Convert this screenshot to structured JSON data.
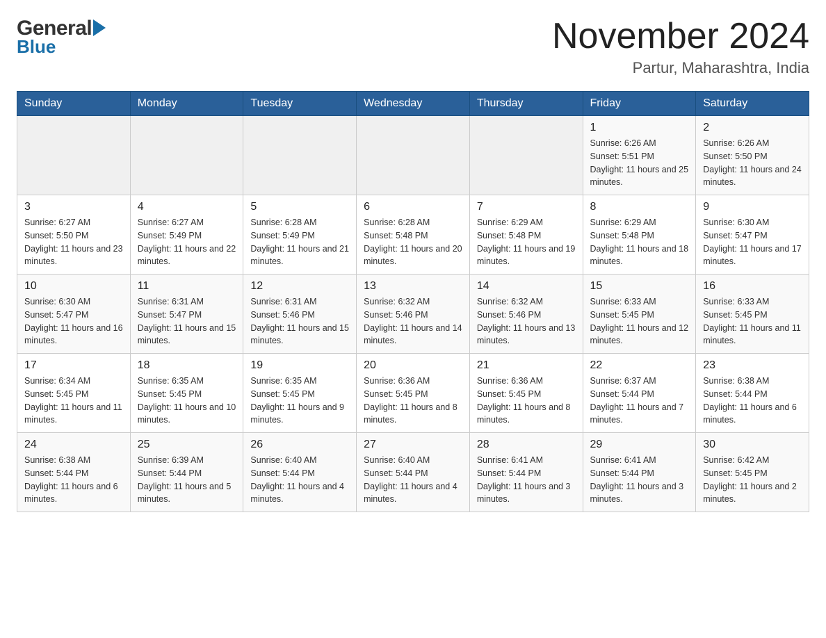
{
  "logo": {
    "line1": "General",
    "line2": "Blue"
  },
  "title": {
    "month_year": "November 2024",
    "location": "Partur, Maharashtra, India"
  },
  "weekdays": [
    "Sunday",
    "Monday",
    "Tuesday",
    "Wednesday",
    "Thursday",
    "Friday",
    "Saturday"
  ],
  "weeks": [
    [
      {
        "day": "",
        "sunrise": "",
        "sunset": "",
        "daylight": ""
      },
      {
        "day": "",
        "sunrise": "",
        "sunset": "",
        "daylight": ""
      },
      {
        "day": "",
        "sunrise": "",
        "sunset": "",
        "daylight": ""
      },
      {
        "day": "",
        "sunrise": "",
        "sunset": "",
        "daylight": ""
      },
      {
        "day": "",
        "sunrise": "",
        "sunset": "",
        "daylight": ""
      },
      {
        "day": "1",
        "sunrise": "Sunrise: 6:26 AM",
        "sunset": "Sunset: 5:51 PM",
        "daylight": "Daylight: 11 hours and 25 minutes."
      },
      {
        "day": "2",
        "sunrise": "Sunrise: 6:26 AM",
        "sunset": "Sunset: 5:50 PM",
        "daylight": "Daylight: 11 hours and 24 minutes."
      }
    ],
    [
      {
        "day": "3",
        "sunrise": "Sunrise: 6:27 AM",
        "sunset": "Sunset: 5:50 PM",
        "daylight": "Daylight: 11 hours and 23 minutes."
      },
      {
        "day": "4",
        "sunrise": "Sunrise: 6:27 AM",
        "sunset": "Sunset: 5:49 PM",
        "daylight": "Daylight: 11 hours and 22 minutes."
      },
      {
        "day": "5",
        "sunrise": "Sunrise: 6:28 AM",
        "sunset": "Sunset: 5:49 PM",
        "daylight": "Daylight: 11 hours and 21 minutes."
      },
      {
        "day": "6",
        "sunrise": "Sunrise: 6:28 AM",
        "sunset": "Sunset: 5:48 PM",
        "daylight": "Daylight: 11 hours and 20 minutes."
      },
      {
        "day": "7",
        "sunrise": "Sunrise: 6:29 AM",
        "sunset": "Sunset: 5:48 PM",
        "daylight": "Daylight: 11 hours and 19 minutes."
      },
      {
        "day": "8",
        "sunrise": "Sunrise: 6:29 AM",
        "sunset": "Sunset: 5:48 PM",
        "daylight": "Daylight: 11 hours and 18 minutes."
      },
      {
        "day": "9",
        "sunrise": "Sunrise: 6:30 AM",
        "sunset": "Sunset: 5:47 PM",
        "daylight": "Daylight: 11 hours and 17 minutes."
      }
    ],
    [
      {
        "day": "10",
        "sunrise": "Sunrise: 6:30 AM",
        "sunset": "Sunset: 5:47 PM",
        "daylight": "Daylight: 11 hours and 16 minutes."
      },
      {
        "day": "11",
        "sunrise": "Sunrise: 6:31 AM",
        "sunset": "Sunset: 5:47 PM",
        "daylight": "Daylight: 11 hours and 15 minutes."
      },
      {
        "day": "12",
        "sunrise": "Sunrise: 6:31 AM",
        "sunset": "Sunset: 5:46 PM",
        "daylight": "Daylight: 11 hours and 15 minutes."
      },
      {
        "day": "13",
        "sunrise": "Sunrise: 6:32 AM",
        "sunset": "Sunset: 5:46 PM",
        "daylight": "Daylight: 11 hours and 14 minutes."
      },
      {
        "day": "14",
        "sunrise": "Sunrise: 6:32 AM",
        "sunset": "Sunset: 5:46 PM",
        "daylight": "Daylight: 11 hours and 13 minutes."
      },
      {
        "day": "15",
        "sunrise": "Sunrise: 6:33 AM",
        "sunset": "Sunset: 5:45 PM",
        "daylight": "Daylight: 11 hours and 12 minutes."
      },
      {
        "day": "16",
        "sunrise": "Sunrise: 6:33 AM",
        "sunset": "Sunset: 5:45 PM",
        "daylight": "Daylight: 11 hours and 11 minutes."
      }
    ],
    [
      {
        "day": "17",
        "sunrise": "Sunrise: 6:34 AM",
        "sunset": "Sunset: 5:45 PM",
        "daylight": "Daylight: 11 hours and 11 minutes."
      },
      {
        "day": "18",
        "sunrise": "Sunrise: 6:35 AM",
        "sunset": "Sunset: 5:45 PM",
        "daylight": "Daylight: 11 hours and 10 minutes."
      },
      {
        "day": "19",
        "sunrise": "Sunrise: 6:35 AM",
        "sunset": "Sunset: 5:45 PM",
        "daylight": "Daylight: 11 hours and 9 minutes."
      },
      {
        "day": "20",
        "sunrise": "Sunrise: 6:36 AM",
        "sunset": "Sunset: 5:45 PM",
        "daylight": "Daylight: 11 hours and 8 minutes."
      },
      {
        "day": "21",
        "sunrise": "Sunrise: 6:36 AM",
        "sunset": "Sunset: 5:45 PM",
        "daylight": "Daylight: 11 hours and 8 minutes."
      },
      {
        "day": "22",
        "sunrise": "Sunrise: 6:37 AM",
        "sunset": "Sunset: 5:44 PM",
        "daylight": "Daylight: 11 hours and 7 minutes."
      },
      {
        "day": "23",
        "sunrise": "Sunrise: 6:38 AM",
        "sunset": "Sunset: 5:44 PM",
        "daylight": "Daylight: 11 hours and 6 minutes."
      }
    ],
    [
      {
        "day": "24",
        "sunrise": "Sunrise: 6:38 AM",
        "sunset": "Sunset: 5:44 PM",
        "daylight": "Daylight: 11 hours and 6 minutes."
      },
      {
        "day": "25",
        "sunrise": "Sunrise: 6:39 AM",
        "sunset": "Sunset: 5:44 PM",
        "daylight": "Daylight: 11 hours and 5 minutes."
      },
      {
        "day": "26",
        "sunrise": "Sunrise: 6:40 AM",
        "sunset": "Sunset: 5:44 PM",
        "daylight": "Daylight: 11 hours and 4 minutes."
      },
      {
        "day": "27",
        "sunrise": "Sunrise: 6:40 AM",
        "sunset": "Sunset: 5:44 PM",
        "daylight": "Daylight: 11 hours and 4 minutes."
      },
      {
        "day": "28",
        "sunrise": "Sunrise: 6:41 AM",
        "sunset": "Sunset: 5:44 PM",
        "daylight": "Daylight: 11 hours and 3 minutes."
      },
      {
        "day": "29",
        "sunrise": "Sunrise: 6:41 AM",
        "sunset": "Sunset: 5:44 PM",
        "daylight": "Daylight: 11 hours and 3 minutes."
      },
      {
        "day": "30",
        "sunrise": "Sunrise: 6:42 AM",
        "sunset": "Sunset: 5:45 PM",
        "daylight": "Daylight: 11 hours and 2 minutes."
      }
    ]
  ]
}
